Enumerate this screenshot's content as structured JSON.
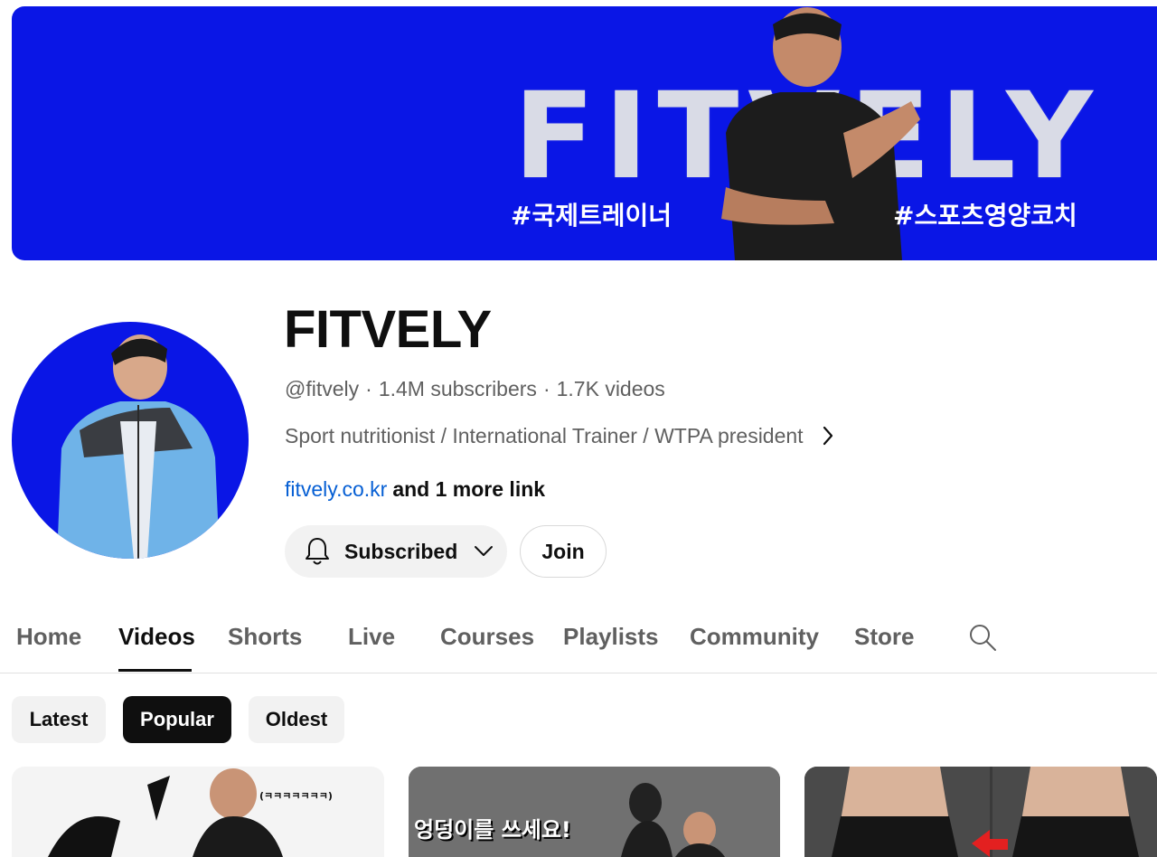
{
  "banner": {
    "word": "FITVELY",
    "tag_left": "#국제트레이너",
    "tag_right": "#스포츠영양코치"
  },
  "channel": {
    "name": "FITVELY",
    "handle": "@fitvely",
    "subscribers": "1.4M subscribers",
    "videos": "1.7K videos",
    "separator": "·",
    "description": "Sport nutritionist / International Trainer / WTPA president",
    "link": "fitvely.co.kr",
    "more_links": "and 1 more link"
  },
  "actions": {
    "subscribe_label": "Subscribed",
    "join_label": "Join"
  },
  "tabs": [
    {
      "label": "Home"
    },
    {
      "label": "Videos"
    },
    {
      "label": "Shorts"
    },
    {
      "label": "Live"
    },
    {
      "label": "Courses"
    },
    {
      "label": "Playlists"
    },
    {
      "label": "Community"
    },
    {
      "label": "Store"
    }
  ],
  "active_tab": "Videos",
  "chips": [
    {
      "label": "Latest"
    },
    {
      "label": "Popular"
    },
    {
      "label": "Oldest"
    }
  ],
  "selected_chip": "Popular",
  "thumbnails": [
    {
      "caption": "(ㅋㅋㅋㅋㅋㅋㅋ)"
    },
    {
      "caption": "엉덩이를 쓰세요!"
    },
    {
      "caption": ""
    }
  ],
  "colors": {
    "brand_blue": "#0a16e6",
    "link_blue": "#065fd4",
    "text_primary": "#0f0f0f",
    "text_secondary": "#606060",
    "chip_bg": "#f2f2f2"
  },
  "icons": {
    "description_more": "chevron-right-icon",
    "subscribe_bell": "bell-icon",
    "subscribe_menu": "chevron-down-icon",
    "search": "search-icon"
  }
}
